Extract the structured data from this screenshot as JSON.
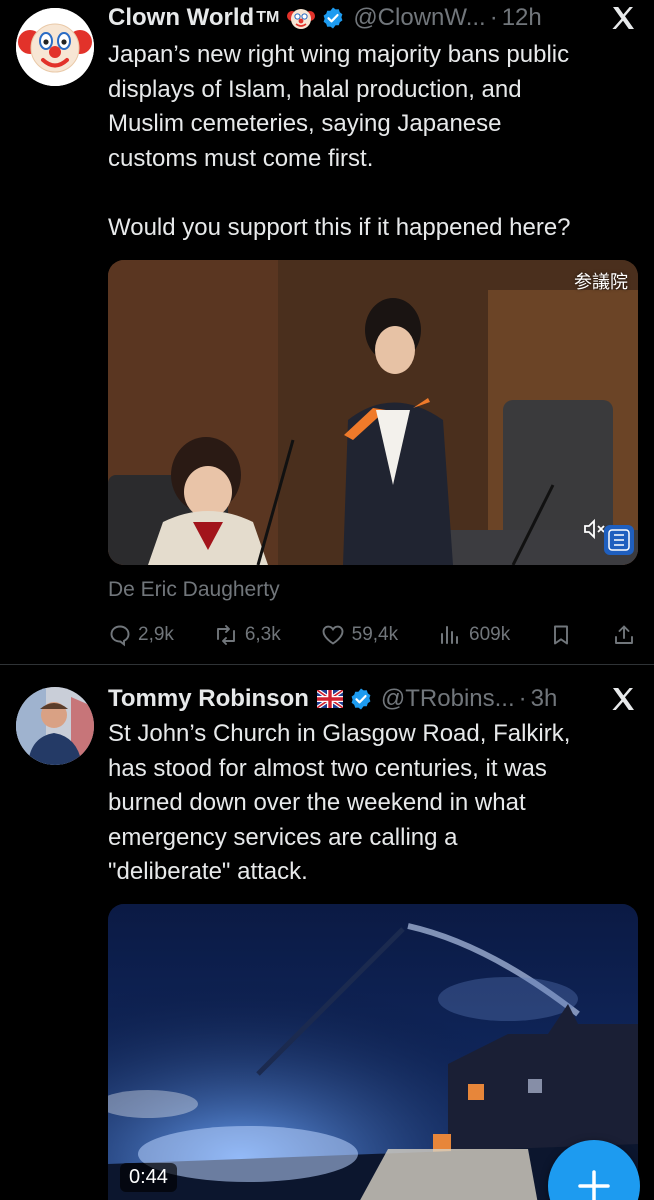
{
  "feed": {
    "tweets": [
      {
        "name": "Clown World",
        "trademark": "TM",
        "badge_emoji": "clown-face",
        "verified": true,
        "handle": "@ClownW...",
        "separator": "·",
        "time": "12h",
        "text": "Japan’s new right wing majority bans public\ndisplays of Islam, halal production, and\nMuslim cemeteries, saying Japanese\ncustoms must come first.\n\nWould you support this if it happened here?",
        "media": {
          "type": "video",
          "overlay_text": "参議院"
        },
        "attribution": "De Eric Daugherty",
        "actions": {
          "replies": "2,9k",
          "reposts": "6,3k",
          "likes": "59,4k",
          "views": "609k"
        }
      },
      {
        "name": "Tommy Robinson",
        "flag_emoji": "uk-flag",
        "verified": true,
        "handle": "@TRobins...",
        "separator": "·",
        "time": "3h",
        "text": "St John’s Church in Glasgow Road, Falkirk,\nhas stood for almost two centuries, it was\nburned down over the weekend in what\nemergency services are calling a\n\"deliberate\" attack.",
        "media": {
          "type": "video",
          "duration": "0:44"
        }
      }
    ]
  },
  "colors": {
    "background": "#000000",
    "text": "#e7e9ea",
    "secondary": "#71767b",
    "verified": "#1d9bf0",
    "accent": "#1d9bf0"
  },
  "fab": {
    "icon": "plus-icon"
  }
}
